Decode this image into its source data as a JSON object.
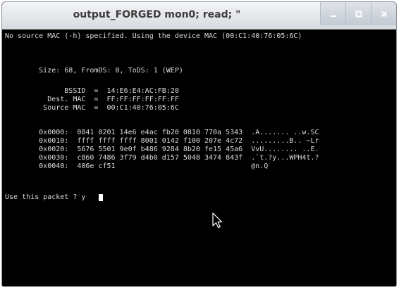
{
  "window": {
    "title": "output_FORGED mon0; read; \""
  },
  "controls": {
    "minimize_icon": "minimize-icon",
    "maximize_icon": "maximize-icon",
    "close_icon": "close-icon"
  },
  "terminal": {
    "line_mac_notice": "No source MAC (-h) specified. Using the device MAC (00:C1:40:76:05:6C)",
    "line_size": "        Size: 68, FromDS: 0, ToDS: 1 (WEP)",
    "line_bssid": "              BSSID  =  14:E6:E4:AC:FB:20",
    "line_dest": "          Dest. MAC  =  FF:FF:FF:FF:FF:FF",
    "line_source": "         Source MAC  =  00:C1:40:76:05:6C",
    "hex_rows": [
      "        0x0000:  0841 0201 14e6 e4ac fb20 0810 770a 5343  .A....... ..w.SC",
      "        0x0010:  ffff ffff ffff 8001 0142 f100 207e 4c72  .........B.. ~Lr",
      "        0x0020:  5676 5501 9e0f b486 9284 8b20 fe15 45a6  VvU........ ..E.",
      "        0x0030:  c860 7486 3f79 d4b0 d157 5048 3474 843f  .`t.?y...WPH4t.?",
      "        0x0040:  406e cf51                                @n.Q"
    ],
    "prompt": "Use this packet ? ",
    "input_value": "y"
  }
}
